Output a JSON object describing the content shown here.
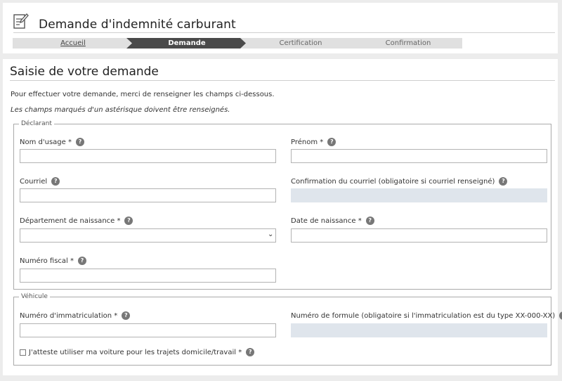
{
  "app": {
    "title": "Demande d'indemnité carburant",
    "icon": "form-edit-icon"
  },
  "steps": [
    {
      "label": "Accueil",
      "state": "link"
    },
    {
      "label": "Demande",
      "state": "active"
    },
    {
      "label": "Certification",
      "state": "todo"
    },
    {
      "label": "Confirmation",
      "state": "todo"
    }
  ],
  "form": {
    "title": "Saisie de votre demande",
    "intro": "Pour effectuer votre demande, merci de renseigner les champs ci-dessous.",
    "note": "Les champs marqués d'un astérisque doivent être renseignés.",
    "declarant": {
      "legend": "Déclarant",
      "nom_label": "Nom d'usage *",
      "prenom_label": "Prénom *",
      "courriel_label": "Courriel",
      "courriel_confirm_label": "Confirmation du courriel (obligatoire si courriel renseigné)",
      "departement_label": "Département de naissance *",
      "date_label": "Date de naissance *",
      "numero_fiscal_label": "Numéro fiscal *"
    },
    "vehicule": {
      "legend": "Véhicule",
      "immat_label": "Numéro d'immatriculation *",
      "formule_label": "Numéro de formule (obligatoire si l'immatriculation est du type XX-000-XX)",
      "attest_label": "J'atteste utiliser ma voiture pour les trajets domicile/travail *"
    },
    "help_glyph": "?"
  },
  "colors": {
    "active_step": "#4a4a4a",
    "inactive_step": "#e0e0e0",
    "disabled_input": "#dfe5ec",
    "help_icon": "#777777"
  }
}
